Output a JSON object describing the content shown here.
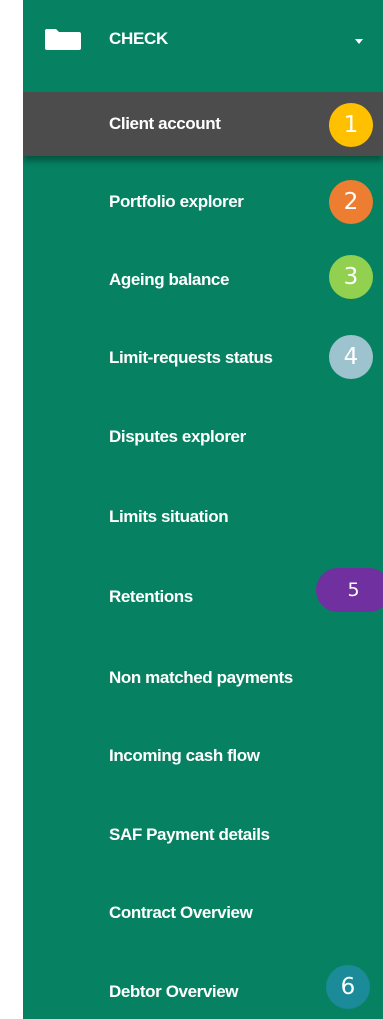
{
  "menu": {
    "header": {
      "label": "CHECK",
      "icon": "folder-icon",
      "expand_icon": "caret-down-icon"
    },
    "items": [
      {
        "label": "Client account",
        "active": true
      },
      {
        "label": "Portfolio explorer"
      },
      {
        "label": "Ageing balance"
      },
      {
        "label": "Limit-requests status"
      },
      {
        "label": "Disputes explorer"
      },
      {
        "label": "Limits situation"
      },
      {
        "label": "Retentions"
      },
      {
        "label": "Non matched payments"
      },
      {
        "label": "Incoming cash flow"
      },
      {
        "label": "SAF Payment details"
      },
      {
        "label": "Contract Overview"
      },
      {
        "label": "Debtor Overview"
      }
    ]
  },
  "badges": [
    {
      "number": "1",
      "color": "#FFC000"
    },
    {
      "number": "2",
      "color": "#ED7D31"
    },
    {
      "number": "3",
      "color": "#92D050"
    },
    {
      "number": "4",
      "color": "#9DC3CE"
    },
    {
      "number": "5",
      "color": "#7030A0"
    },
    {
      "number": "6",
      "color": "#1B8A99"
    }
  ],
  "colors": {
    "panel_background": "#068262",
    "active_background": "#4C4C4C",
    "text": "#FFFFFF"
  }
}
